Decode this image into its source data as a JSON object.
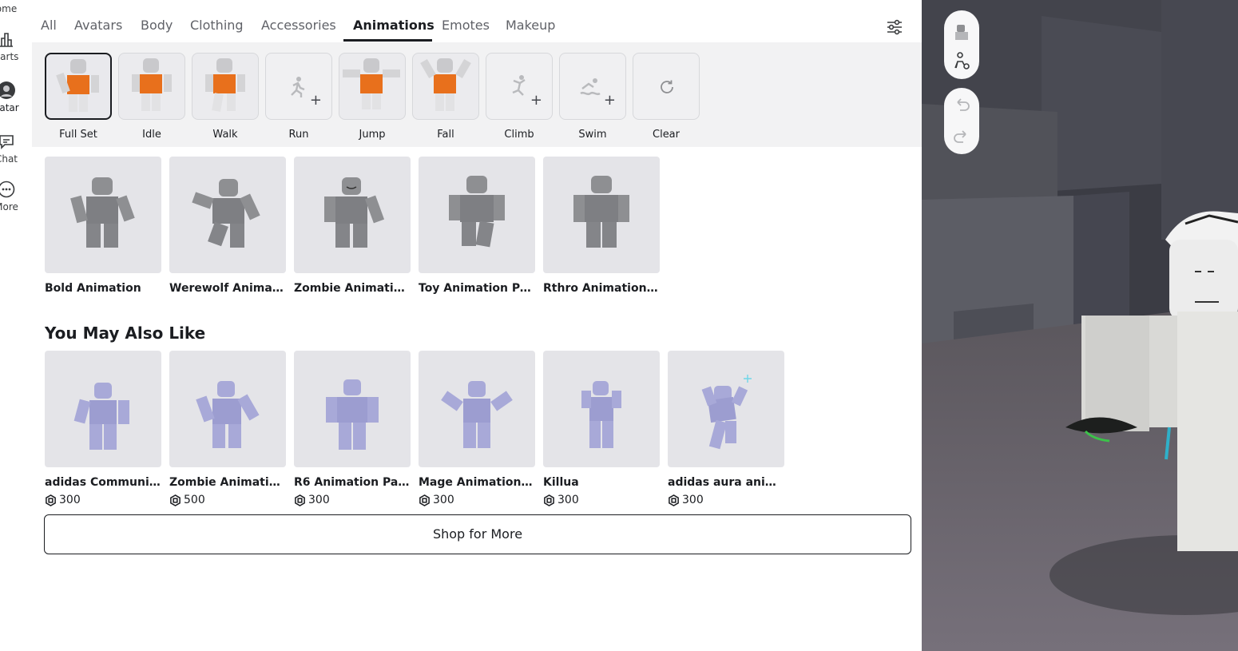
{
  "left_nav": {
    "items": [
      {
        "label": "ome",
        "icon": "home-icon"
      },
      {
        "label": "harts",
        "icon": "charts-icon"
      },
      {
        "label": "vatar",
        "icon": "avatar-icon"
      },
      {
        "label": "Chat",
        "icon": "chat-icon"
      },
      {
        "label": "More",
        "icon": "more-icon"
      }
    ]
  },
  "tabs": {
    "items": [
      {
        "label": "All"
      },
      {
        "label": "Avatars"
      },
      {
        "label": "Body"
      },
      {
        "label": "Clothing"
      },
      {
        "label": "Accessories"
      },
      {
        "label": "Animations",
        "active": true
      },
      {
        "label": "Emotes"
      },
      {
        "label": "Makeup"
      }
    ],
    "filter_icon": "sliders-icon"
  },
  "slots": [
    {
      "label": "Full Set",
      "selected": true,
      "filled": true
    },
    {
      "label": "Idle",
      "filled": true
    },
    {
      "label": "Walk",
      "filled": true
    },
    {
      "label": "Run",
      "filled": false,
      "icon": "run-icon"
    },
    {
      "label": "Jump",
      "filled": true
    },
    {
      "label": "Fall",
      "filled": true
    },
    {
      "label": "Climb",
      "filled": false,
      "icon": "climb-icon"
    },
    {
      "label": "Swim",
      "filled": false,
      "icon": "swim-icon"
    },
    {
      "label": "Clear",
      "icon": "refresh-icon"
    }
  ],
  "owned": [
    {
      "title": "Bold Animation"
    },
    {
      "title": "Werewolf Animatio..."
    },
    {
      "title": "Zombie Animation ..."
    },
    {
      "title": "Toy Animation Pack"
    },
    {
      "title": "Rthro Animation Pa..."
    }
  ],
  "recommended": {
    "title": "You May Also Like",
    "items": [
      {
        "title": "adidas Community ...",
        "price": "300"
      },
      {
        "title": "Zombie Animation ...",
        "price": "500"
      },
      {
        "title": "R6 Animation Pack",
        "price": "300"
      },
      {
        "title": "Mage Animation Pa...",
        "price": "300"
      },
      {
        "title": "Killua",
        "price": "300"
      },
      {
        "title": "adidas aura animati...",
        "price": "300"
      }
    ]
  },
  "shop_button": "Shop for More",
  "viewport": {
    "buttons": [
      "avatar-preview-icon",
      "avatar-settings-icon",
      "undo-icon",
      "redo-icon"
    ]
  },
  "colors": {
    "accent": "#1b1d21",
    "slot_bg": "#f2f2f3",
    "owned_thumb": "#e4e4e8",
    "figure_gray": "#8e8f92",
    "figure_lilac": "#a8a9d8",
    "shirt_orange": "#e8701c"
  }
}
